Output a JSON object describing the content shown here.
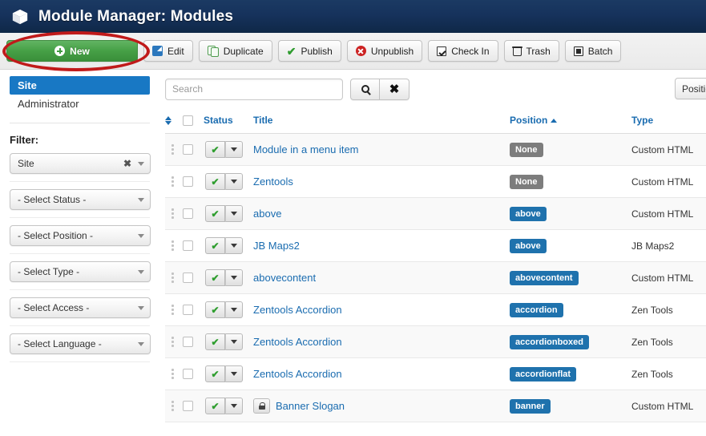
{
  "header": {
    "title": "Module Manager: Modules",
    "icon": "cube-icon",
    "bg_color": "#16325c"
  },
  "toolbar": {
    "buttons": [
      {
        "label": "New",
        "icon": "plus-circle-icon",
        "style": "primary"
      },
      {
        "label": "Edit",
        "icon": "edit-pencil-icon",
        "style": "default"
      },
      {
        "label": "Duplicate",
        "icon": "copy-icon",
        "style": "default"
      },
      {
        "label": "Publish",
        "icon": "checkmark-icon",
        "style": "default"
      },
      {
        "label": "Unpublish",
        "icon": "x-circle-icon",
        "style": "default"
      },
      {
        "label": "Check In",
        "icon": "checkbox-icon",
        "style": "default"
      },
      {
        "label": "Trash",
        "icon": "trash-icon",
        "style": "default"
      },
      {
        "label": "Batch",
        "icon": "batch-square-icon",
        "style": "default"
      }
    ]
  },
  "annotation": {
    "type": "red-ellipse-highlight",
    "target": "new-button",
    "color": "#c01a1a"
  },
  "sidebar": {
    "tabs": [
      {
        "label": "Site",
        "active": true
      },
      {
        "label": "Administrator",
        "active": false
      }
    ],
    "filter_heading": "Filter:",
    "filters": [
      {
        "name": "client",
        "value": "Site",
        "clearable": true,
        "clear_label": "✖"
      },
      {
        "name": "status",
        "value": "- Select Status -",
        "clearable": false
      },
      {
        "name": "position",
        "value": "- Select Position -",
        "clearable": false
      },
      {
        "name": "type",
        "value": "- Select Type -",
        "clearable": false
      },
      {
        "name": "access",
        "value": "- Select Access -",
        "clearable": false
      },
      {
        "name": "language",
        "value": "- Select Language -",
        "clearable": false
      }
    ]
  },
  "search": {
    "value": "",
    "placeholder": "Search",
    "search_icon": "magnifier-icon",
    "clear_icon": "x-icon"
  },
  "order_select": {
    "value": "Position"
  },
  "table": {
    "columns": [
      {
        "key": "ordering",
        "label": "",
        "icon": "sort-updown-icon"
      },
      {
        "key": "checkbox",
        "label": ""
      },
      {
        "key": "status",
        "label": "Status"
      },
      {
        "key": "title",
        "label": "Title"
      },
      {
        "key": "position",
        "label": "Position",
        "sorted": "asc",
        "sort_icon": "caret-up-icon"
      },
      {
        "key": "type",
        "label": "Type"
      }
    ],
    "rows": [
      {
        "status": "published",
        "status_icon": "checkmark-icon",
        "title": "Module in a menu item",
        "locked": false,
        "position": "None",
        "position_style": "none",
        "type": "Custom HTML"
      },
      {
        "status": "published",
        "status_icon": "checkmark-icon",
        "title": "Zentools",
        "locked": false,
        "position": "None",
        "position_style": "none",
        "type": "Custom HTML"
      },
      {
        "status": "published",
        "status_icon": "checkmark-icon",
        "title": "above",
        "locked": false,
        "position": "above",
        "position_style": "blue",
        "type": "Custom HTML"
      },
      {
        "status": "published",
        "status_icon": "checkmark-icon",
        "title": "JB Maps2",
        "locked": false,
        "position": "above",
        "position_style": "blue",
        "type": "JB Maps2"
      },
      {
        "status": "published",
        "status_icon": "checkmark-icon",
        "title": "abovecontent",
        "locked": false,
        "position": "abovecontent",
        "position_style": "blue",
        "type": "Custom HTML"
      },
      {
        "status": "published",
        "status_icon": "checkmark-icon",
        "title": "Zentools Accordion",
        "locked": false,
        "position": "accordion",
        "position_style": "blue",
        "type": "Zen Tools"
      },
      {
        "status": "published",
        "status_icon": "checkmark-icon",
        "title": "Zentools Accordion",
        "locked": false,
        "position": "accordionboxed",
        "position_style": "blue",
        "type": "Zen Tools"
      },
      {
        "status": "published",
        "status_icon": "checkmark-icon",
        "title": "Zentools Accordion",
        "locked": false,
        "position": "accordionflat",
        "position_style": "blue",
        "type": "Zen Tools"
      },
      {
        "status": "published",
        "status_icon": "checkmark-icon",
        "title": "Banner Slogan",
        "locked": true,
        "lock_icon": "lock-icon",
        "position": "banner",
        "position_style": "blue",
        "type": "Custom HTML"
      }
    ]
  },
  "colors": {
    "header_navy": "#16325c",
    "link_blue": "#1a6cb0",
    "active_blue": "#1878c4",
    "badge_blue": "#1f72ad",
    "badge_gray": "#7d7d7d",
    "new_green": "#46a046",
    "annotation_red": "#c01a1a"
  }
}
